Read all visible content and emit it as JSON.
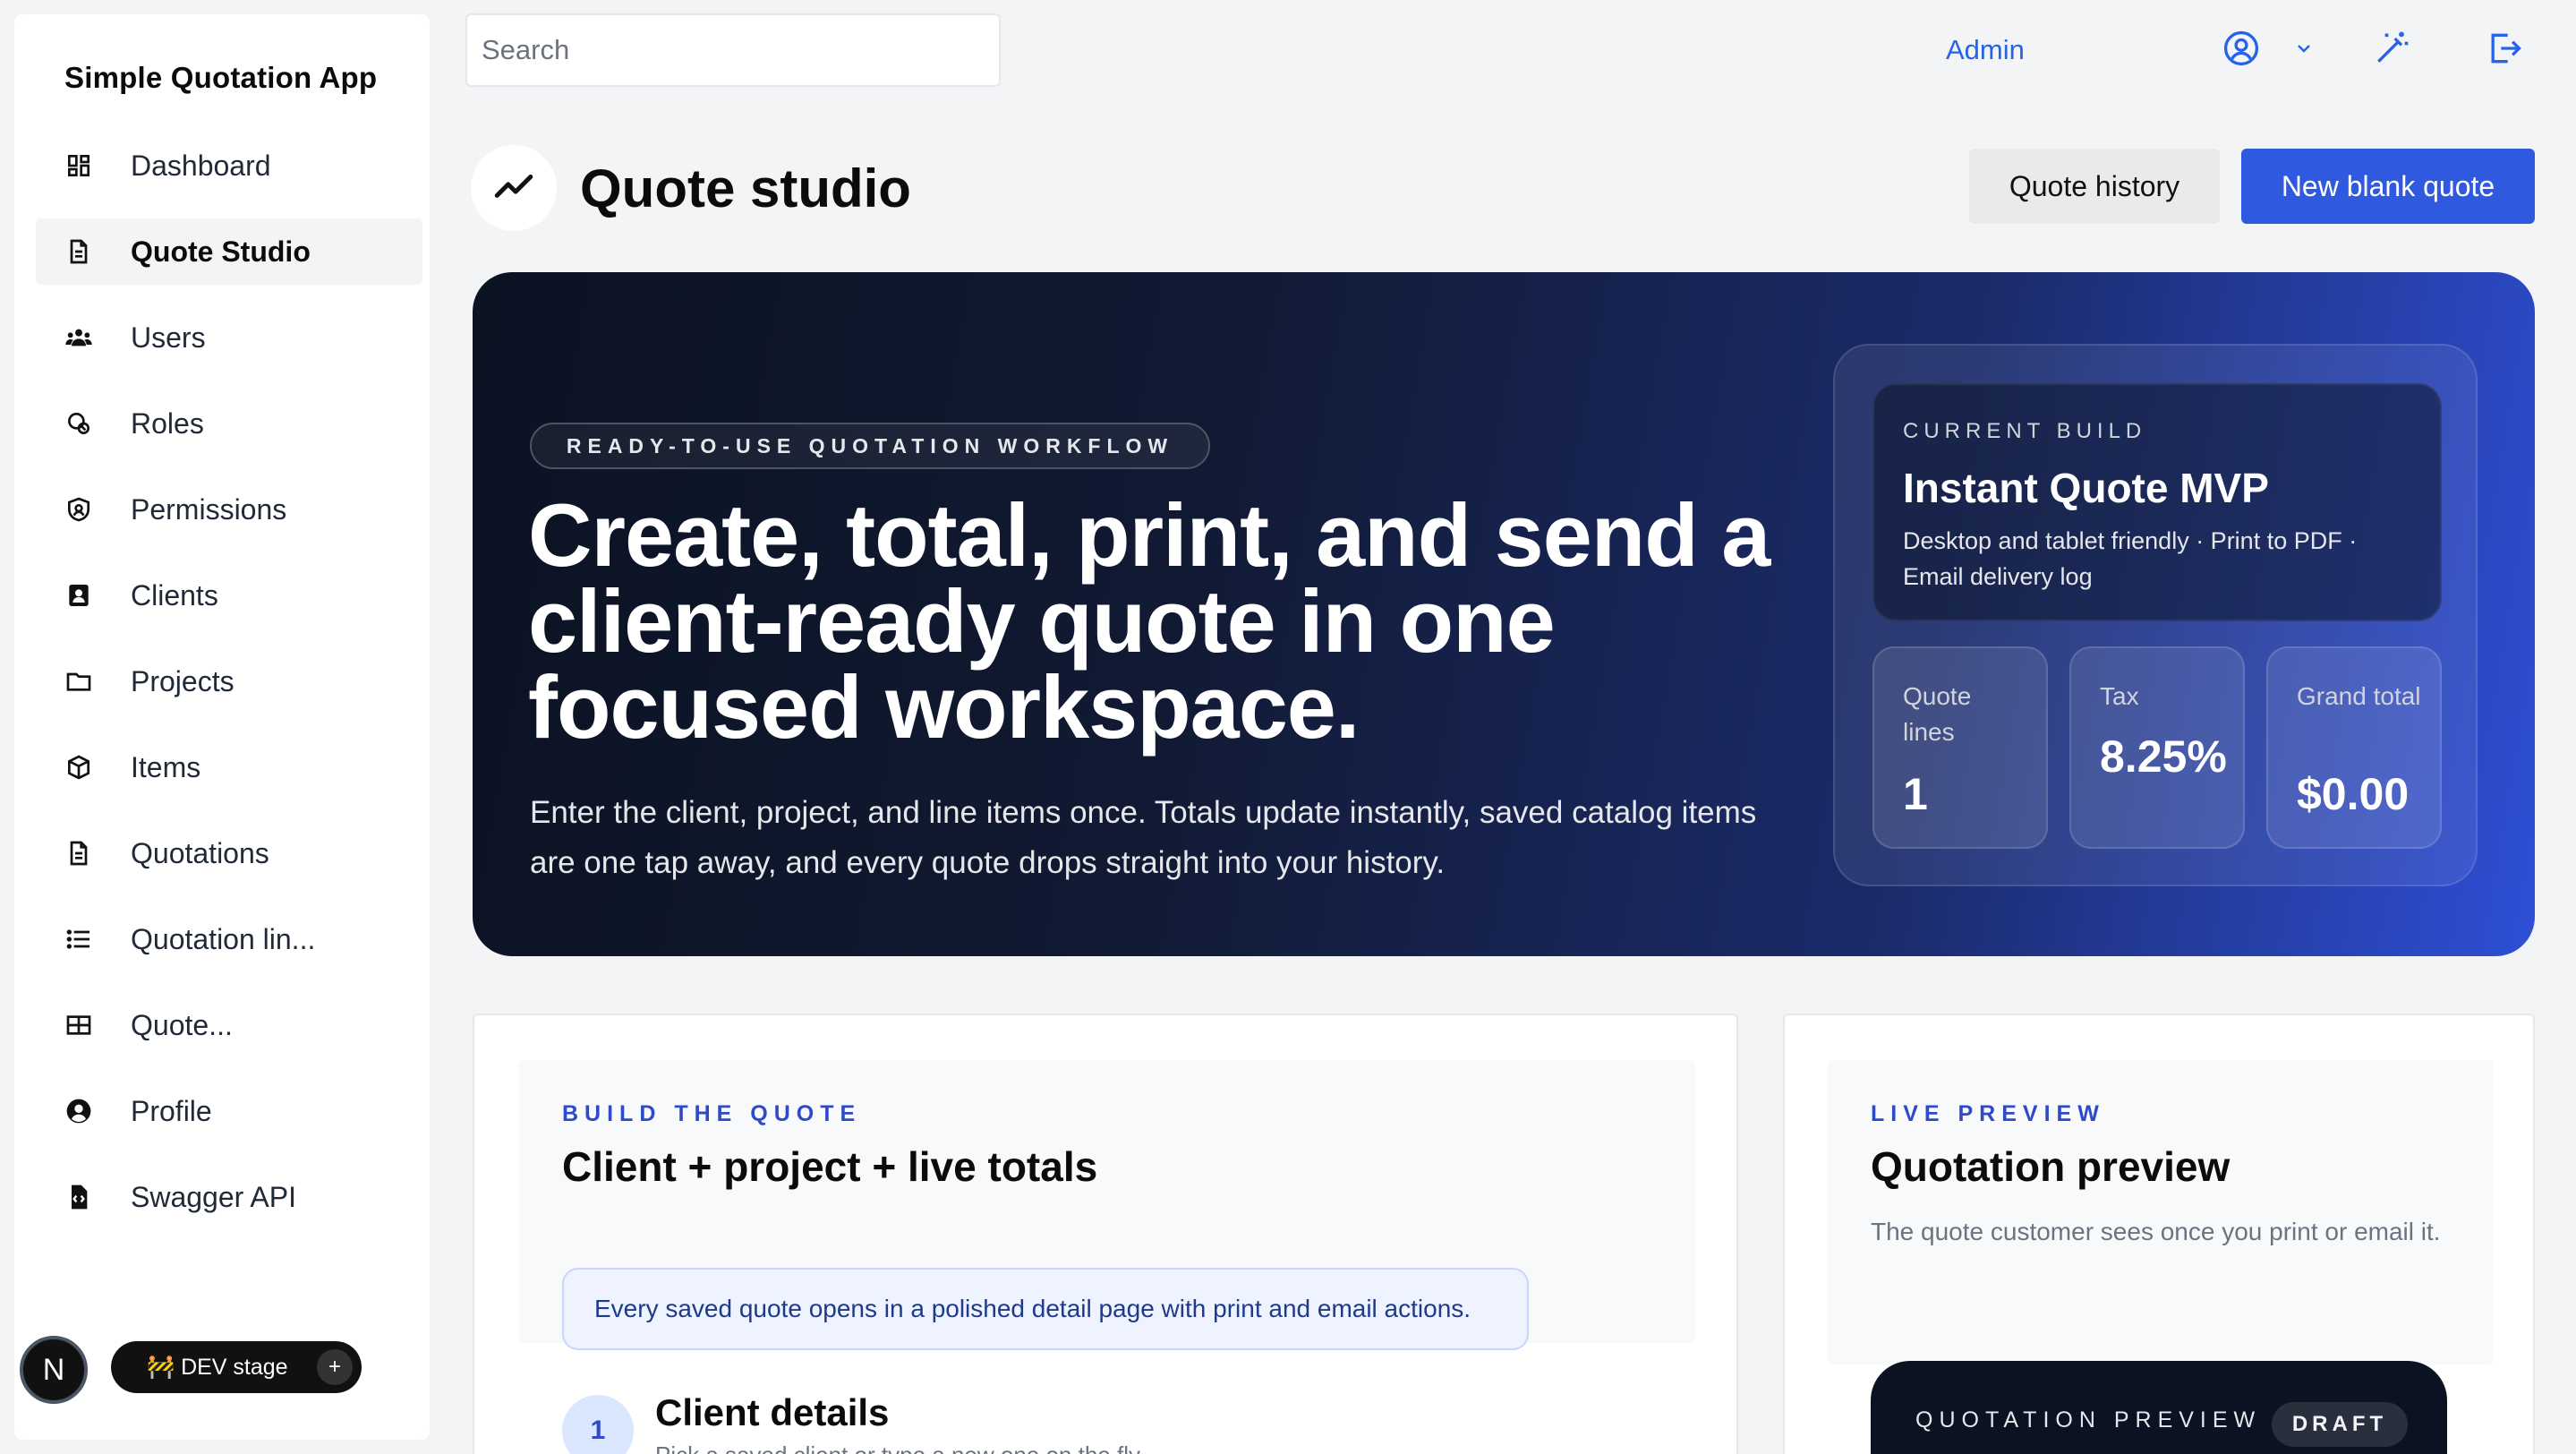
{
  "sidebar": {
    "app_title": "Simple Quotation App",
    "items": [
      {
        "label": "Dashboard",
        "icon": "dashboard-icon"
      },
      {
        "label": "Quote Studio",
        "icon": "document-icon",
        "active": true
      },
      {
        "label": "Users",
        "icon": "users-icon"
      },
      {
        "label": "Roles",
        "icon": "roles-icon"
      },
      {
        "label": "Permissions",
        "icon": "shield-icon"
      },
      {
        "label": "Clients",
        "icon": "contact-card-icon"
      },
      {
        "label": "Projects",
        "icon": "folder-icon"
      },
      {
        "label": "Items",
        "icon": "cube-icon"
      },
      {
        "label": "Quotations",
        "icon": "document-icon"
      },
      {
        "label": "Quotation lin...",
        "icon": "list-icon"
      },
      {
        "label": "Quote...",
        "icon": "table-icon"
      },
      {
        "label": "Profile",
        "icon": "user-circle-icon"
      },
      {
        "label": "Swagger API",
        "icon": "code-file-icon"
      }
    ],
    "avatar_letter": "N",
    "dev_badge": "🚧 DEV stage",
    "dev_badge_plus": "+"
  },
  "topbar": {
    "search_placeholder": "Search",
    "admin_label": "Admin",
    "icons": [
      "user-circle-icon",
      "chevron-down-icon",
      "magic-wand-icon",
      "logout-icon"
    ]
  },
  "header": {
    "icon": "trend-line-icon",
    "title": "Quote studio",
    "history_button": "Quote history",
    "new_button": "New blank quote"
  },
  "hero": {
    "badge": "READY-TO-USE QUOTATION WORKFLOW",
    "heading": "Create, total, print, and send a client-ready quote in one focused workspace.",
    "subtext": "Enter the client, project, and line items once. Totals update instantly, saved catalog items are one tap away, and every quote drops straight into your history.",
    "build": {
      "eyebrow": "CURRENT BUILD",
      "name": "Instant Quote MVP",
      "description": "Desktop and tablet friendly · Print to PDF · Email delivery log"
    },
    "stats": [
      {
        "label": "Quote lines",
        "value": "1"
      },
      {
        "label": "Tax",
        "value": "8.25%"
      },
      {
        "label": "Grand total",
        "value": "$0.00"
      }
    ]
  },
  "build_section": {
    "eyebrow": "BUILD THE QUOTE",
    "title": "Client + project + live totals",
    "info": "Every saved quote opens in a polished detail page with print and email actions.",
    "step_number": "1",
    "step_title": "Client details",
    "step_subtitle": "Pick a saved client or type a new one on the fly."
  },
  "preview_section": {
    "eyebrow": "LIVE PREVIEW",
    "title": "Quotation preview",
    "description": "The quote customer sees once you print or email it.",
    "panel_label": "QUOTATION PREVIEW",
    "status_badge": "DRAFT"
  },
  "colors": {
    "accent": "#2f5ae0",
    "admin_link": "#2563eb",
    "eyebrow_blue": "#2f4ac9",
    "hero_dark": "#0b1222",
    "hero_bright": "#2e4fd6"
  }
}
